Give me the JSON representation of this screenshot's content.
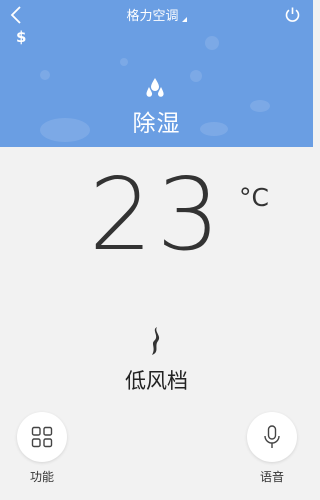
{
  "header": {
    "title": "格力空调",
    "back_icon": "chevron-left-icon",
    "dollar_icon": "$",
    "power_icon": "power-icon"
  },
  "mode": {
    "icon": "dehumidify-drops-icon",
    "label": "除湿"
  },
  "temperature": {
    "value": "23",
    "unit": "°C"
  },
  "fan": {
    "icon": "fan-speed-icon",
    "label": "低风档"
  },
  "bottom": {
    "function_label": "功能",
    "voice_label": "语音"
  },
  "colors": {
    "header_bg": "#6a9ee3",
    "body_bg": "#f2f2f2"
  }
}
